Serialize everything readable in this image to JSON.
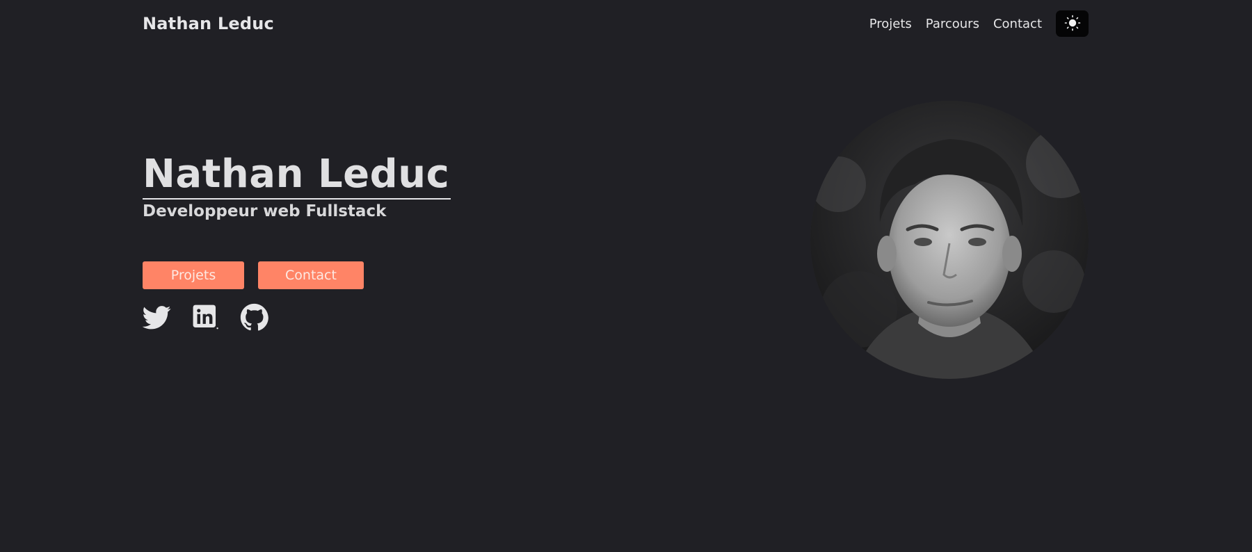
{
  "nav": {
    "brand": "Nathan Leduc",
    "links": [
      "Projets",
      "Parcours",
      "Contact"
    ],
    "theme_toggle_icon": "sun-icon"
  },
  "hero": {
    "name": "Nathan Leduc",
    "subtitle": "Developpeur web Fullstack",
    "buttons": {
      "projects": "Projets",
      "contact": "Contact"
    },
    "socials": [
      "twitter-icon",
      "linkedin-icon",
      "github-icon"
    ],
    "avatar_alt": "portrait"
  },
  "colors": {
    "background": "#202025",
    "accent": "#ff8466",
    "text": "#e6e6e8",
    "toggle_bg": "#050506"
  }
}
